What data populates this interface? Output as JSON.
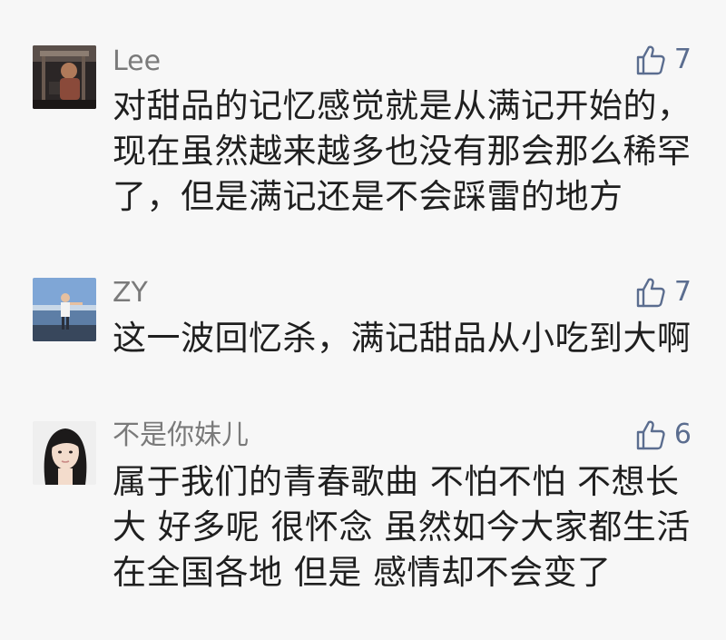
{
  "comments": [
    {
      "username": "Lee",
      "likes": "7",
      "lines": [
        "对甜品的记忆感觉就是从满记开始的，",
        "现在虽然越来越多也没有那会那么稀罕",
        "了，但是满记还是不会踩雷的地方"
      ]
    },
    {
      "username": "ZY",
      "likes": "7",
      "lines": [
        "这一波回忆杀，满记甜品从小吃到大啊"
      ]
    },
    {
      "username": "不是你妹儿",
      "likes": "6",
      "lines": [
        "属于我们的青春歌曲 不怕不怕 不想长",
        "大 好多呢 很怀念 虽然如今大家都生活",
        "在全国各地 但是 感情却不会变了"
      ]
    }
  ],
  "colors": {
    "background": "#f7f7f7",
    "username": "#7a7a7a",
    "like": "#5b6d8f",
    "text": "#1f1f1f"
  },
  "icons": {
    "like": "thumbs-up-icon"
  }
}
